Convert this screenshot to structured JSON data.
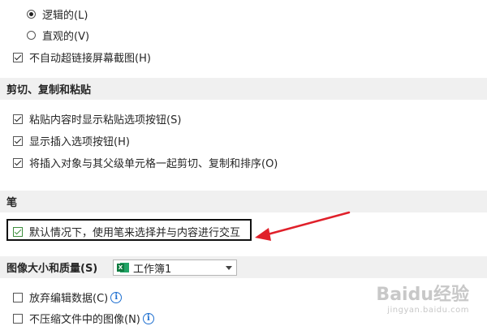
{
  "top_options": {
    "radio_logical": "逻辑的(L)",
    "radio_visual": "直观的(V)",
    "no_auto_hyperlink": "不自动超链接屏幕截图(H)"
  },
  "section_clipboard": {
    "title": "剪切、复制和粘贴",
    "items": [
      "粘贴内容时显示粘贴选项按钮(S)",
      "显示插入选项按钮(H)",
      "将插入对象与其父级单元格一起剪切、复制和排序(O)"
    ]
  },
  "section_pen": {
    "title": "笔",
    "item": "默认情况下，使用笔来选择并与内容进行交互"
  },
  "section_image": {
    "title": "图像大小和质量(S)",
    "workbook_value": "工作簿1",
    "excel_icon_letter": "X",
    "discard_editing": "放弃编辑数据(C)",
    "no_compress": "不压缩文件中的图像(N)",
    "info_glyph": "i"
  },
  "annotation": {
    "arrow_color": "#e0202a"
  },
  "watermark": {
    "brand": "Baidu经验",
    "url": "jingyan.baidu.com"
  }
}
